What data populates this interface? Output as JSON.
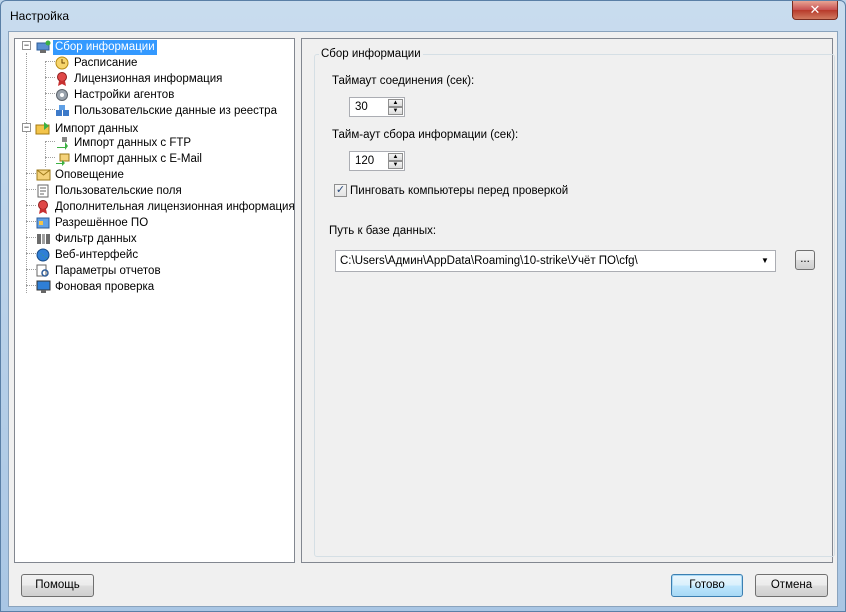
{
  "window": {
    "title": "Настройка",
    "close_glyph": "✕"
  },
  "tree": {
    "items": [
      {
        "id": "collect",
        "label": "Сбор информации",
        "icon": "network-computer-icon",
        "selected": true,
        "expander": "−"
      },
      {
        "id": "schedule",
        "label": "Расписание",
        "icon": "clock-icon"
      },
      {
        "id": "license",
        "label": "Лицензионная информация",
        "icon": "license-ribbon-icon"
      },
      {
        "id": "agents",
        "label": "Настройки агентов",
        "icon": "gear-icon"
      },
      {
        "id": "registry",
        "label": "Пользовательские данные из реестра",
        "icon": "registry-icon"
      },
      {
        "id": "import",
        "label": "Импорт данных",
        "icon": "import-folder-icon",
        "expander": "−"
      },
      {
        "id": "ftp",
        "label": "Импорт данных с FTP",
        "icon": "ftp-arrow-icon"
      },
      {
        "id": "email",
        "label": "Импорт данных с E-Mail",
        "icon": "email-arrow-icon"
      },
      {
        "id": "notify",
        "label": "Оповещение",
        "icon": "envelope-icon"
      },
      {
        "id": "custom-fields",
        "label": "Пользовательские поля",
        "icon": "document-icon"
      },
      {
        "id": "extra-license",
        "label": "Дополнительная лицензионная информация",
        "icon": "license-ribbon-icon"
      },
      {
        "id": "allowed",
        "label": "Разрешённое ПО",
        "icon": "allowed-software-icon"
      },
      {
        "id": "filter",
        "label": "Фильтр данных",
        "icon": "filter-icon"
      },
      {
        "id": "web",
        "label": "Веб-интерфейс",
        "icon": "globe-icon"
      },
      {
        "id": "reports",
        "label": "Параметры отчетов",
        "icon": "report-magnifier-icon"
      },
      {
        "id": "background",
        "label": "Фоновая проверка",
        "icon": "monitor-icon"
      }
    ]
  },
  "settings": {
    "group_title": "Сбор информации",
    "timeout_label": "Таймаут соединения (сек):",
    "timeout_value": "30",
    "collect_timeout_label": "Тайм-аут сбора информации (сек):",
    "collect_timeout_value": "120",
    "ping_label": "Пинговать компьютеры перед проверкой",
    "ping_checked": true,
    "db_path_label": "Путь к базе данных:",
    "db_path_value": "C:\\Users\\Админ\\AppData\\Roaming\\10-strike\\Учёт ПО\\cfg\\",
    "browse_label": "..."
  },
  "buttons": {
    "help": "Помощь",
    "ok": "Готово",
    "cancel": "Отмена"
  },
  "glyphs": {
    "check": "✓",
    "up": "▲",
    "down": "▼",
    "dropdown": "▼"
  }
}
